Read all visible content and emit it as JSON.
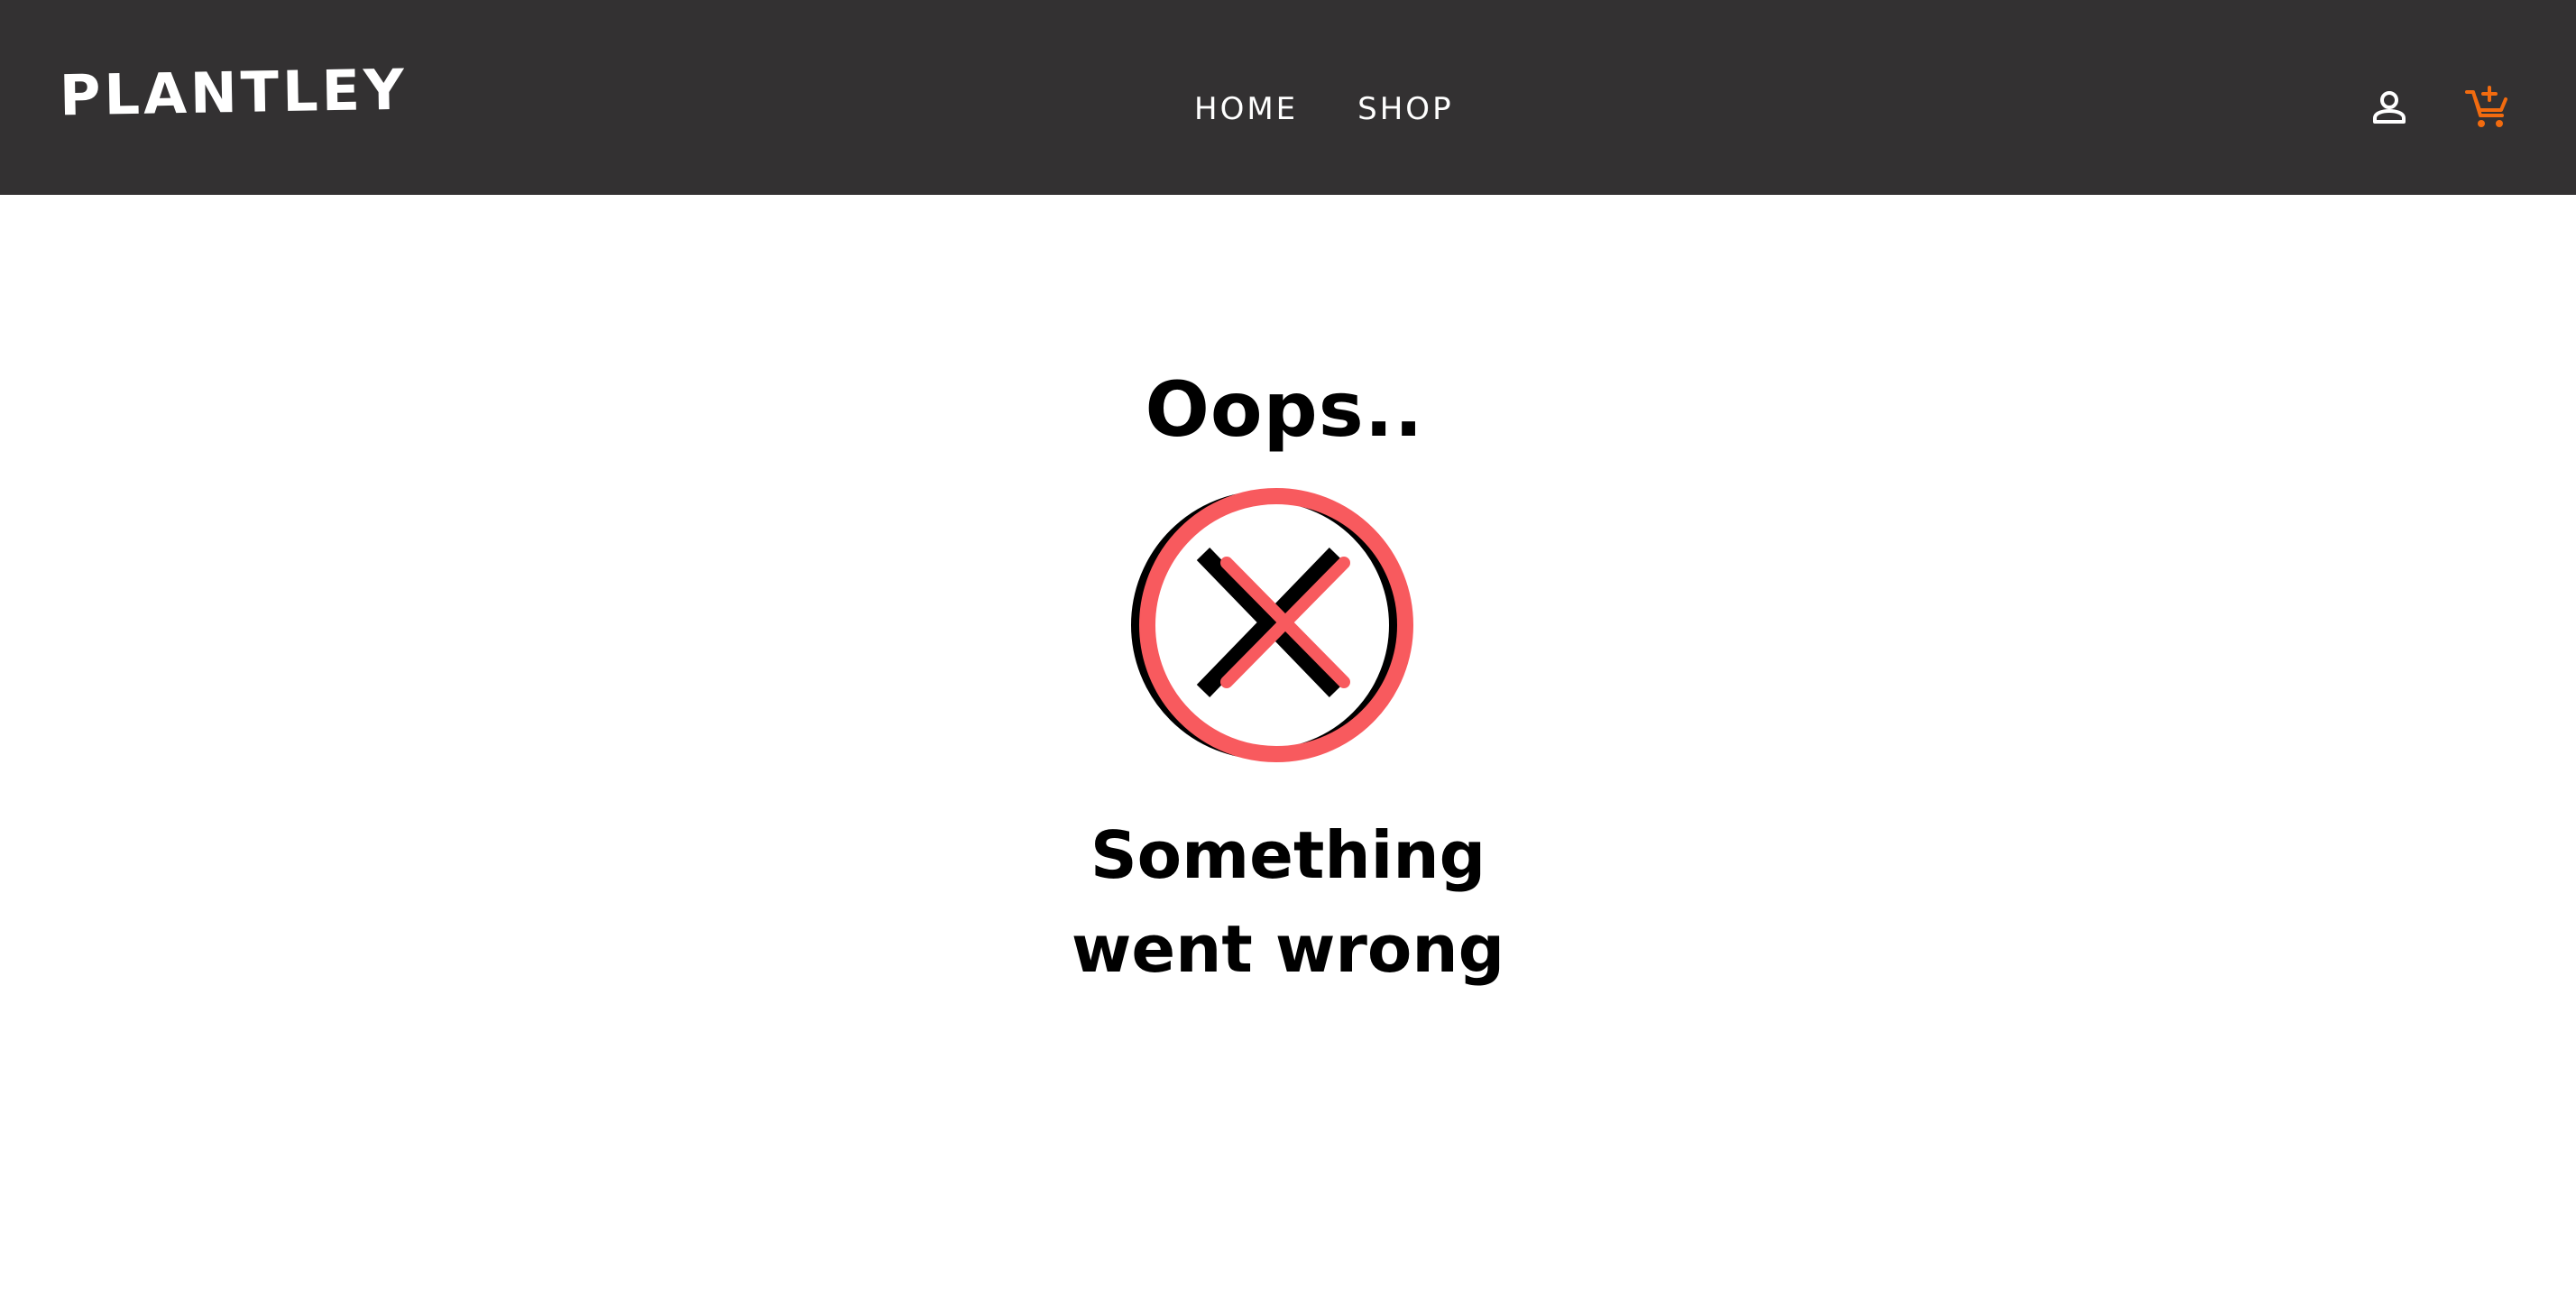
{
  "header": {
    "brand": "PLANTLEY",
    "nav": [
      {
        "label": "HOME"
      },
      {
        "label": "SHOP"
      }
    ],
    "icons": {
      "account": "person-icon",
      "cart": "add-shopping-cart-icon"
    },
    "colors": {
      "background": "#333132",
      "text": "#ffffff",
      "cart_accent": "#f26b0f"
    }
  },
  "error": {
    "title": "Oops..",
    "message_line_1": "Something",
    "message_line_2": "went wrong",
    "icon": "x-circle-icon",
    "colors": {
      "accent": "#f85a5e",
      "text": "#000000"
    }
  }
}
